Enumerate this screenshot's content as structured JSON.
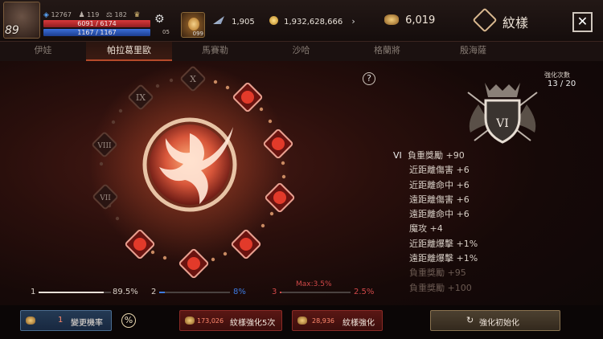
{
  "player": {
    "level": "89",
    "stat1": "12767",
    "stat2": "119",
    "stat3": "182",
    "hp": "6091 / 6174",
    "mp": "1167 / 1167",
    "item_count": "05",
    "item_count2": "099"
  },
  "currencies": {
    "feather": "1,905",
    "gold": "1,932,628,666",
    "emblem": "6,019"
  },
  "header": {
    "title": "紋樣",
    "close_label": "✕"
  },
  "tabs": [
    {
      "label": "伊娃",
      "active": false
    },
    {
      "label": "帕拉葛里歐",
      "active": true
    },
    {
      "label": "馬賽勒",
      "active": false
    },
    {
      "label": "沙哈",
      "active": false
    },
    {
      "label": "格蘭將",
      "active": false
    },
    {
      "label": "殷海薩",
      "active": false
    }
  ],
  "wheel": {
    "numerals_locked": [
      "X",
      "IX",
      "VIII",
      "VII"
    ],
    "help_label": "?"
  },
  "enhance": {
    "count_title": "強化次數",
    "count_value": "13 / 20",
    "badge_numeral": "VI"
  },
  "stats": [
    {
      "numeral": "VI",
      "text": "負重獎勵 +90",
      "indent": false,
      "dim": false
    },
    {
      "numeral": "",
      "text": "近距離傷害 +6",
      "indent": true,
      "dim": false
    },
    {
      "numeral": "",
      "text": "近距離命中 +6",
      "indent": true,
      "dim": false
    },
    {
      "numeral": "",
      "text": "遠距離傷害 +6",
      "indent": true,
      "dim": false
    },
    {
      "numeral": "",
      "text": "遠距離命中 +6",
      "indent": true,
      "dim": false
    },
    {
      "numeral": "",
      "text": "魔攻 +4",
      "indent": true,
      "dim": false
    },
    {
      "numeral": "",
      "text": "近距離爆擊 +1%",
      "indent": true,
      "dim": false
    },
    {
      "numeral": "",
      "text": "遠距離爆擊 +1%",
      "indent": true,
      "dim": false
    },
    {
      "numeral": "",
      "text": "負重獎勵 +95",
      "indent": true,
      "dim": true
    },
    {
      "numeral": "",
      "text": "負重獎勵 +100",
      "indent": true,
      "dim": true
    }
  ],
  "progress": [
    {
      "index": "1",
      "value": "89.5%",
      "fraction": 0.895,
      "color": "#e8e0d8"
    },
    {
      "index": "2",
      "value": "8%",
      "fraction": 0.08,
      "color": "#3d7ae0"
    },
    {
      "index": "3",
      "value": "2.5%",
      "fraction": 0.025,
      "color": "#d04848",
      "max_label": "Max:3.5%"
    }
  ],
  "buttons": {
    "rate_count": "1",
    "rate_label": "變更機率",
    "percent_label": "%",
    "enhance5_cost": "173,026",
    "enhance5_label": "紋樣強化5次",
    "enhance1_cost": "28,936",
    "enhance1_label": "紋樣強化",
    "reset_label": "強化初始化"
  },
  "colors": {
    "accent": "#b54a2a",
    "gold": "#e9c27a",
    "hp": "#d8383a",
    "mp": "#3a6fd8"
  }
}
